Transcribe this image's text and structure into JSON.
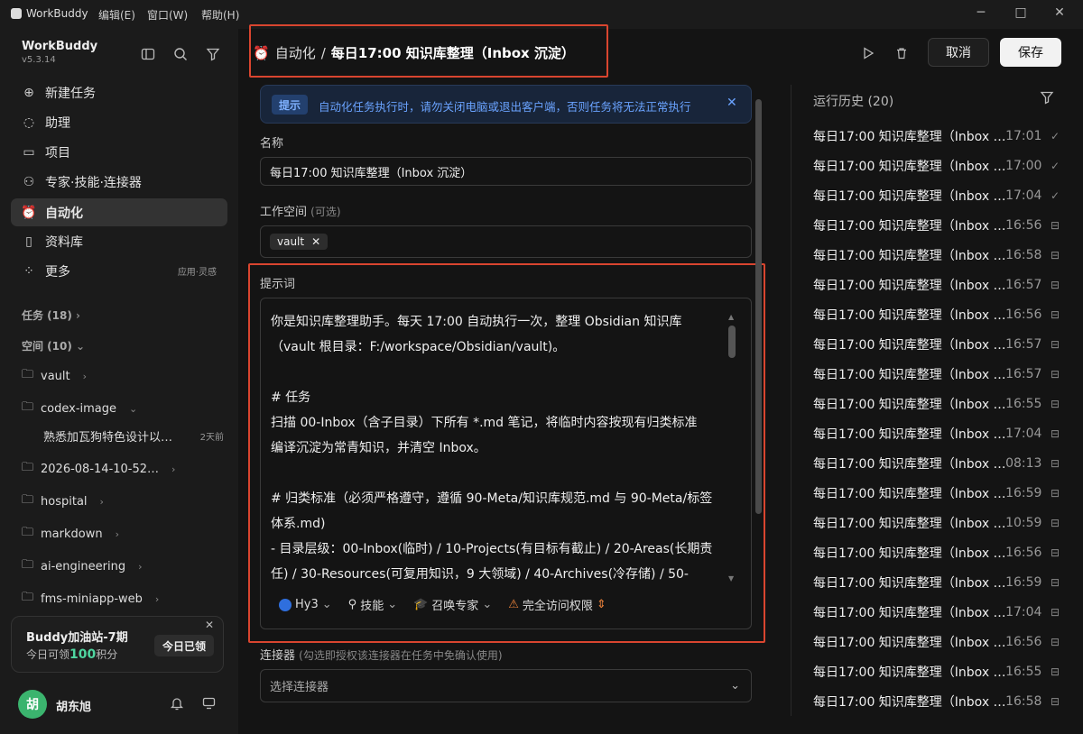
{
  "titlebar": {
    "app_name": "WorkBuddy",
    "menus": [
      "编辑(E)",
      "窗口(W)",
      "帮助(H)"
    ]
  },
  "sidebar": {
    "brand": "WorkBuddy",
    "version": "v5.3.14",
    "nav": [
      {
        "label": "新建任务",
        "icon": "plus-circle-icon"
      },
      {
        "label": "助理",
        "icon": "chat-icon"
      },
      {
        "label": "项目",
        "icon": "project-icon"
      },
      {
        "label": "专家·技能·连接器",
        "icon": "expert-icon"
      },
      {
        "label": "自动化",
        "icon": "alarm-clock-icon",
        "active": true
      },
      {
        "label": "资料库",
        "icon": "book-icon"
      },
      {
        "label": "更多",
        "icon": "grid-icon",
        "extra": "应用·灵感"
      }
    ],
    "tasks_label": "任务 (18)",
    "spaces_label": "空间 (10)",
    "folders": [
      "vault",
      "codex-image",
      "2026-08-14-10-52…",
      "hospital",
      "markdown",
      "ai-engineering",
      "fms-miniapp-web"
    ],
    "sub_item": {
      "label": "熟悉加瓦狗特色设计以…",
      "when": "2天前"
    },
    "promo": {
      "title": "Buddy加油站-7期",
      "line_prefix": "今日可领",
      "points": "100",
      "line_suffix": "积分",
      "button": "今日已领"
    },
    "user": {
      "name": "胡东旭",
      "avatar_letter": "胡"
    }
  },
  "header": {
    "breadcrumb_parent": "自动化",
    "separator": "/",
    "title": "每日17:00 知识库整理（Inbox 沉淀）",
    "cancel_label": "取消",
    "save_label": "保存"
  },
  "tip": {
    "tag": "提示",
    "message": "自动化任务执行时，请勿关闭电脑或退出客户端，否则任务将无法正常执行"
  },
  "form": {
    "name_label": "名称",
    "name_value": "每日17:00 知识库整理（Inbox 沉淀）",
    "workspace_label": "工作空间",
    "workspace_optional": "(可选)",
    "workspace_chip": "vault",
    "prompt_label": "提示词",
    "prompt_text": "你是知识库整理助手。每天 17:00 自动执行一次，整理 Obsidian 知识库\n（vault 根目录：F:/workspace/Obsidian/vault)。\n\n# 任务\n扫描 00-Inbox（含子目录）下所有 *.md 笔记，将临时内容按现有归类标准\n编译沉淀为常青知识，并清空 Inbox。\n\n# 归类标准（必须严格遵守，遵循 90-Meta/知识库规范.md 与 90-Meta/标签\n体系.md)\n- 目录层级：00-Inbox(临时) / 10-Projects(有目标有截止) / 20-Areas(长期责\n任) / 30-Resources(可复用知识，9 大领域) / 40-Archives(冷存储) / 50-",
    "toolbar": {
      "model": "Hy3",
      "skills": "技能",
      "summon": "召唤专家",
      "access": "完全访问权限"
    },
    "connector_label": "连接器",
    "connector_hint": "(勾选即授权该连接器在任务中免确认使用)",
    "connector_placeholder": "选择连接器"
  },
  "history": {
    "title": "运行历史 (20)",
    "rows": [
      {
        "name": "每日17:00 知识库整理（Inbox …",
        "time": "17:01",
        "status": "done"
      },
      {
        "name": "每日17:00 知识库整理（Inbox …",
        "time": "17:00",
        "status": "done"
      },
      {
        "name": "每日17:00 知识库整理（Inbox …",
        "time": "17:04",
        "status": "done"
      },
      {
        "name": "每日17:00 知识库整理（Inbox …",
        "time": "16:56",
        "status": "archived"
      },
      {
        "name": "每日17:00 知识库整理（Inbox …",
        "time": "16:58",
        "status": "archived"
      },
      {
        "name": "每日17:00 知识库整理（Inbox …",
        "time": "16:57",
        "status": "archived"
      },
      {
        "name": "每日17:00 知识库整理（Inbox …",
        "time": "16:56",
        "status": "archived"
      },
      {
        "name": "每日17:00 知识库整理（Inbox …",
        "time": "16:57",
        "status": "archived"
      },
      {
        "name": "每日17:00 知识库整理（Inbox …",
        "time": "16:57",
        "status": "archived"
      },
      {
        "name": "每日17:00 知识库整理（Inbox …",
        "time": "16:55",
        "status": "archived"
      },
      {
        "name": "每日17:00 知识库整理（Inbox …",
        "time": "17:04",
        "status": "archived"
      },
      {
        "name": "每日17:00 知识库整理（Inbox …",
        "time": "08:13",
        "status": "archived"
      },
      {
        "name": "每日17:00 知识库整理（Inbox …",
        "time": "16:59",
        "status": "archived"
      },
      {
        "name": "每日17:00 知识库整理（Inbox …",
        "time": "10:59",
        "status": "archived"
      },
      {
        "name": "每日17:00 知识库整理（Inbox …",
        "time": "16:56",
        "status": "archived"
      },
      {
        "name": "每日17:00 知识库整理（Inbox …",
        "time": "16:59",
        "status": "archived"
      },
      {
        "name": "每日17:00 知识库整理（Inbox …",
        "time": "17:04",
        "status": "archived"
      },
      {
        "name": "每日17:00 知识库整理（Inbox …",
        "time": "16:56",
        "status": "archived"
      },
      {
        "name": "每日17:00 知识库整理（Inbox …",
        "time": "16:55",
        "status": "archived"
      },
      {
        "name": "每日17:00 知识库整理（Inbox …",
        "time": "16:58",
        "status": "archived"
      }
    ]
  },
  "colors": {
    "highlight_box": "#d9452f",
    "tip_text": "#6aa3ff",
    "accent_green": "#4fd6a0"
  }
}
